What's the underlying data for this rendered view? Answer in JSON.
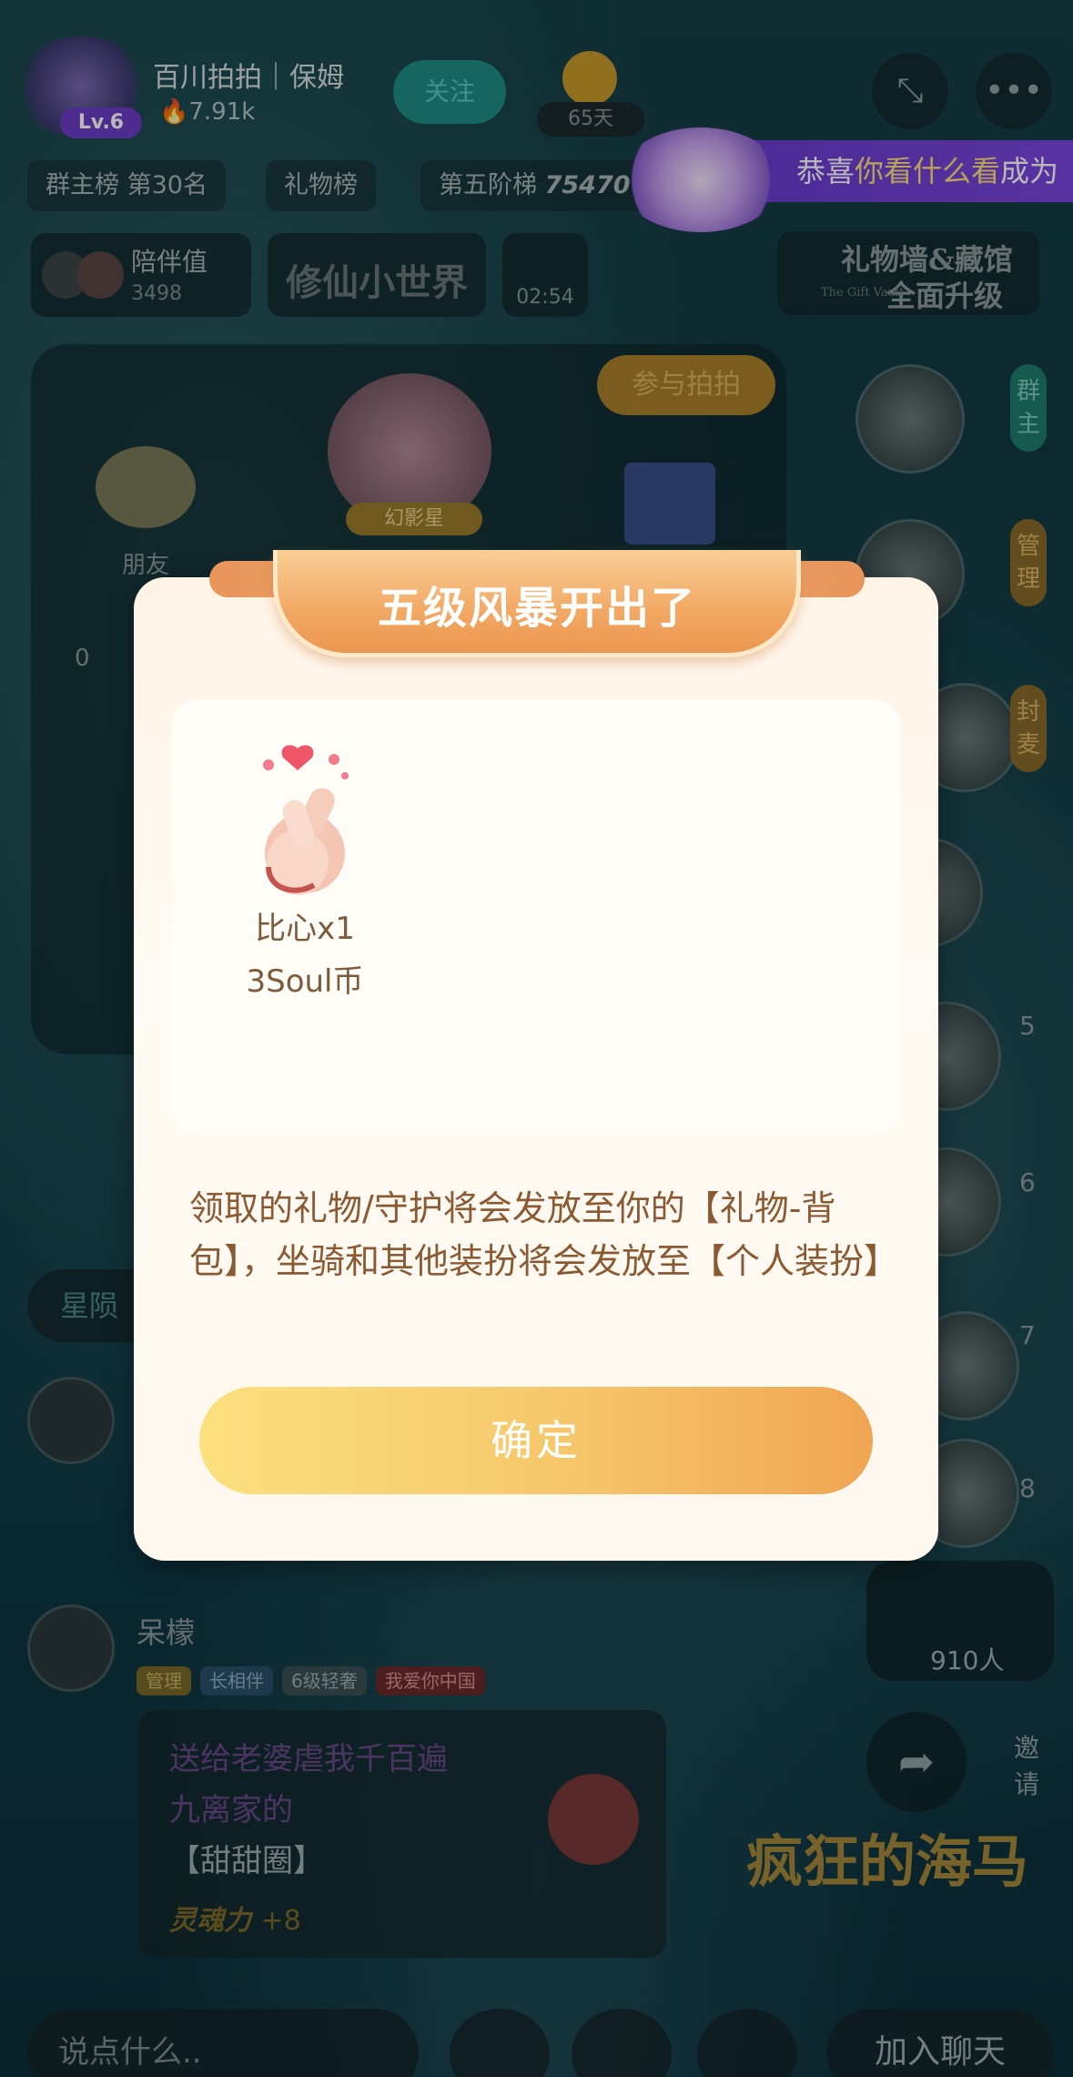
{
  "header": {
    "room_title": "百川拍拍｜保姆",
    "level": "Lv.6",
    "heat": "7.91k",
    "follow_label": "关注",
    "days": "65天"
  },
  "banner": {
    "prefix": "恭喜",
    "highlight": "你看什么看",
    "suffix": "成为"
  },
  "ranks": {
    "group_rank": "群主榜 第30名",
    "gift_rank": "礼物榜",
    "tier_rank": "第五阶梯",
    "tier_value": "75470"
  },
  "info_row": {
    "companion_label": "陪伴值",
    "companion_value": "3498",
    "game_name": "修仙小世界",
    "timer": "02:54",
    "gift_wall_line1": "礼物墙&藏馆",
    "gift_wall_line2": "全面升级",
    "gift_wall_small": "The Gift Vault"
  },
  "stage": {
    "join_label": "参与拍拍",
    "friend_label": "朋友",
    "star_label": "幻影星",
    "count": "0"
  },
  "side_tags": [
    "群主",
    "管理",
    "封麦"
  ],
  "side_numbers": [
    "5",
    "6",
    "7",
    "8"
  ],
  "online_count": "910人",
  "invite_label": "邀请",
  "left_chip": "星陨",
  "chat": {
    "username": "呆檬",
    "badges": [
      "管理",
      "长相伴",
      "6级轻奢",
      "我爱你中国"
    ],
    "line1": "送给老婆虐我千百遍",
    "line2": "九离家的",
    "gift": "【甜甜圈】",
    "soul_label": "灵魂力",
    "soul_value": "+8"
  },
  "game_logo": "疯狂的海马",
  "modal": {
    "title": "五级风暴开出了",
    "gift_name": "比心x1",
    "gift_price": "3Soul币",
    "notice": "领取的礼物/守护将会发放至你的【礼物-背包】，坐骑和其他装扮将会发放至【个人装扮】",
    "confirm_label": "确定"
  },
  "bottom": {
    "input_placeholder": "说点什么..",
    "join_chat_label": "加入聊天"
  },
  "colors": {
    "modal_title": "#ffffff",
    "modal_text": "#8a5a32",
    "confirm_start": "#fbe07e",
    "confirm_end": "#f0a553",
    "banner_purple": "#6a3ccf"
  },
  "icons": [
    "shrink-icon",
    "more-icon",
    "share-icon",
    "chat-bubble-icon",
    "finger-heart-icon",
    "gift-icon"
  ]
}
